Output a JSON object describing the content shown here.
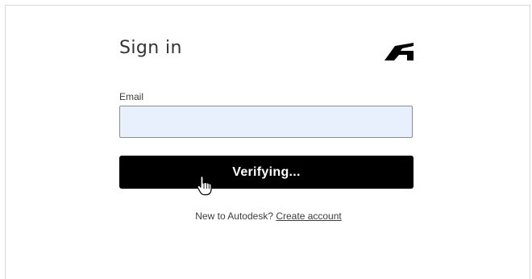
{
  "signin": {
    "title": "Sign in",
    "logo_icon": "autodesk-logo-icon",
    "email_label": "Email",
    "email_value": "",
    "verify_button_label": "Verifying...",
    "signup_prompt": "New to Autodesk?",
    "signup_link": "Create account"
  },
  "colors": {
    "button_bg": "#000000",
    "input_bg": "#e8f0fe",
    "text": "#3c3c3c"
  },
  "cursor_icon": "hand-pointer-icon"
}
